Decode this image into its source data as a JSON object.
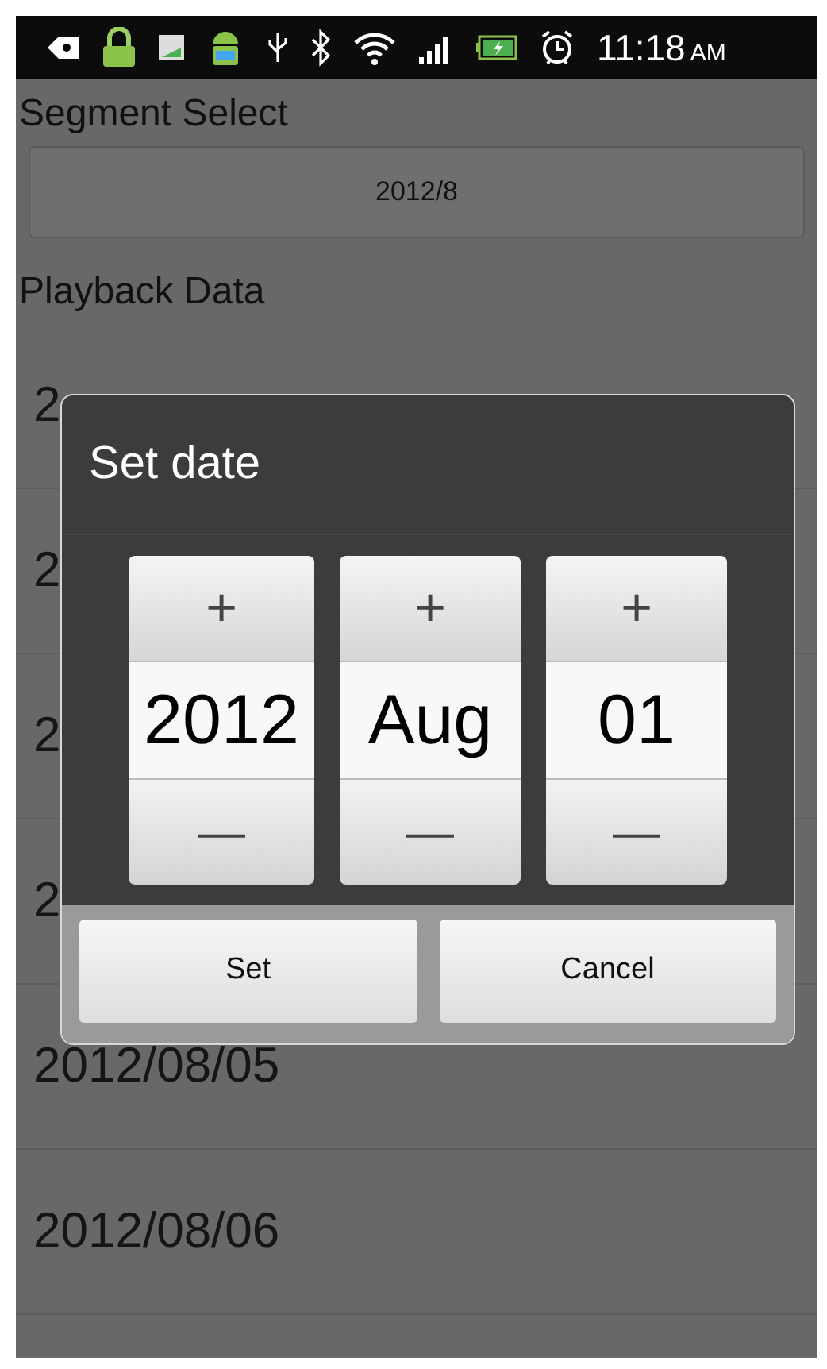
{
  "status_bar": {
    "time": "11:18",
    "ampm": "AM"
  },
  "segment_select": {
    "label": "Segment Select",
    "value": "2012/8"
  },
  "playback": {
    "label": "Playback Data",
    "rows": [
      "2",
      "2",
      "2",
      "2",
      "2012/08/05",
      "2012/08/06"
    ]
  },
  "dialog": {
    "title": "Set date",
    "pickers": [
      {
        "increment": "+",
        "value": "2012",
        "decrement": "—"
      },
      {
        "increment": "+",
        "value": "Aug",
        "decrement": "—"
      },
      {
        "increment": "+",
        "value": "01",
        "decrement": "—"
      }
    ],
    "buttons": [
      "Set",
      "Cancel"
    ]
  }
}
